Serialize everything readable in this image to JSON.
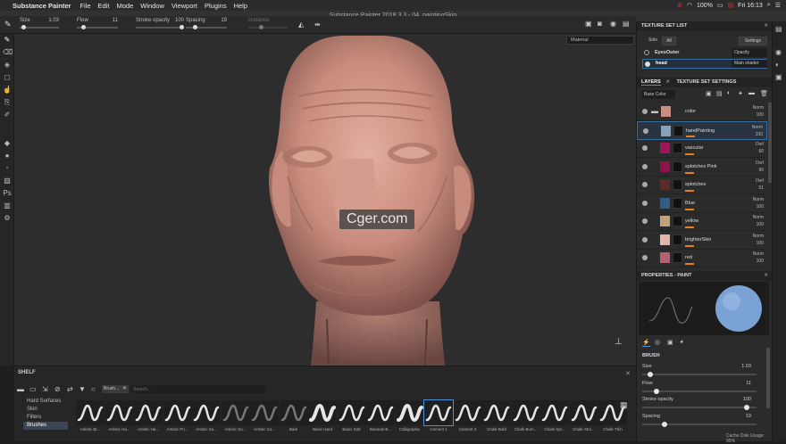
{
  "menubar": {
    "app_name": "Substance Painter",
    "items": [
      "File",
      "Edit",
      "Mode",
      "Window",
      "Viewport",
      "Plugins",
      "Help"
    ],
    "battery": "100%",
    "clock": "Fri 16:13"
  },
  "window_title": "Substance Painter 2018.3.3 - 04_paintingSkin",
  "tool_props": {
    "size": {
      "label": "Size",
      "value": "1.03",
      "fill": 0.05
    },
    "flow": {
      "label": "Flow",
      "value": "11",
      "fill": 0.11
    },
    "stroke_opacity": {
      "label": "Stroke opacity",
      "value": "100",
      "fill": 1.0
    },
    "spacing": {
      "label": "Spacing",
      "value": "19",
      "fill": 0.19
    },
    "distance": {
      "label": "Distance",
      "value": "",
      "fill": 0.3
    }
  },
  "viewport": {
    "material_select": "Material",
    "watermark": "Cger.com"
  },
  "texture_set_list": {
    "title": "TEXTURE SET LIST",
    "solo_label": "Solo",
    "all_label": "All",
    "settings_label": "Settings",
    "rows": [
      {
        "name": "EyesOuter",
        "shader": "Opacity"
      },
      {
        "name": "head",
        "shader": "Main shader"
      }
    ]
  },
  "layers_panel": {
    "tab_layers": "LAYERS",
    "tab_settings": "TEXTURE SET SETTINGS",
    "channel": "Base Color",
    "layers": [
      {
        "name": "color",
        "blend": "Norm",
        "opacity": "100",
        "color": "#c98e82",
        "folder": true
      },
      {
        "name": "handPainting",
        "blend": "Norm",
        "opacity": "100",
        "color": "#8aa2b8",
        "selected": true
      },
      {
        "name": "vascular",
        "blend": "Ovrl",
        "opacity": "60",
        "color": "#a0155a"
      },
      {
        "name": "splotches Pink",
        "blend": "Ovrl",
        "opacity": "60",
        "color": "#8c1448"
      },
      {
        "name": "splotches",
        "blend": "Ovrl",
        "opacity": "51",
        "color": "#5b2a2a"
      },
      {
        "name": "Blue",
        "blend": "Norm",
        "opacity": "100",
        "color": "#2f5e84"
      },
      {
        "name": "yellow",
        "blend": "Norm",
        "opacity": "100",
        "color": "#c4a176"
      },
      {
        "name": "brighterSkin",
        "blend": "Norm",
        "opacity": "100",
        "color": "#e2b6aa"
      },
      {
        "name": "red",
        "blend": "Norm",
        "opacity": "100",
        "color": "#b56070"
      }
    ]
  },
  "properties": {
    "title": "PROPERTIES - PAINT",
    "brush_section": "BRUSH",
    "sliders": [
      {
        "label": "Size",
        "value": "1.03",
        "fill": 0.05
      },
      {
        "label": "Flow",
        "value": "11",
        "fill": 0.11
      },
      {
        "label": "Stroke opacity",
        "value": "100",
        "fill": 1.0
      },
      {
        "label": "Spacing",
        "value": "19",
        "fill": 0.19
      }
    ],
    "cache": "Cache Disk Usage:   95%"
  },
  "shelf": {
    "title": "SHELF",
    "categories": [
      "Hard Surfaces",
      "Skin",
      "Filters",
      "Brushes"
    ],
    "active_category": "Brushes",
    "filter_tag": "Brush...",
    "search_placeholder": "Search...",
    "brushes": [
      "Artistic Br...",
      "Artistic Ha...",
      "Artistic Ha...",
      "Artistic Pri...",
      "Artistic So...",
      "Artistic So...",
      "Artistic So...",
      "Bark",
      "Basic Hard",
      "Basic Soft",
      "Basmati B...",
      "Calligraphic",
      "Cement 1",
      "Cement 2",
      "Chalk Bold",
      "Chalk Bum...",
      "Chalk Spr...",
      "Chalk Stro...",
      "Chalk Thin"
    ],
    "selected_brush": "Cement 1"
  },
  "colors": {
    "accent": "#4a90d9",
    "brush_preview_sphere": "#7aa2d4"
  }
}
